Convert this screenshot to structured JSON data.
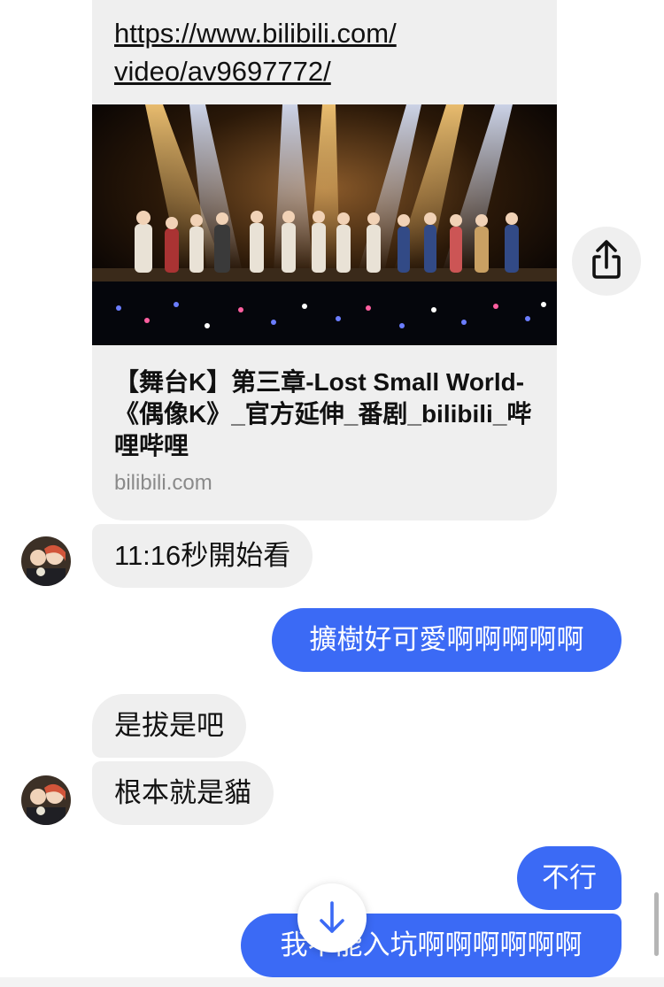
{
  "link_preview": {
    "url_line1": "https://www.bilibili.com/",
    "url_line2": "video/av9697772/",
    "title": "【舞台K】第三章-Lost Small World-《偶像K》_官方延伸_番剧_bilibili_哔哩哔哩",
    "domain": "bilibili.com"
  },
  "messages": [
    {
      "direction": "incoming",
      "text": "11:16秒開始看"
    },
    {
      "direction": "outgoing",
      "text": "擴樹好可愛啊啊啊啊啊"
    },
    {
      "direction": "incoming",
      "text": "是拔是吧"
    },
    {
      "direction": "incoming",
      "text": "根本就是貓"
    },
    {
      "direction": "outgoing",
      "text": "不行"
    },
    {
      "direction": "outgoing",
      "text": "我不能入坑啊啊啊啊啊啊"
    }
  ],
  "icons": {
    "share": "share-icon",
    "scroll_down": "arrow-down-icon",
    "avatar": "avatar"
  },
  "colors": {
    "incoming_bubble": "#efefef",
    "outgoing_bubble": "#3b6af5",
    "accent": "#3b6af5"
  }
}
